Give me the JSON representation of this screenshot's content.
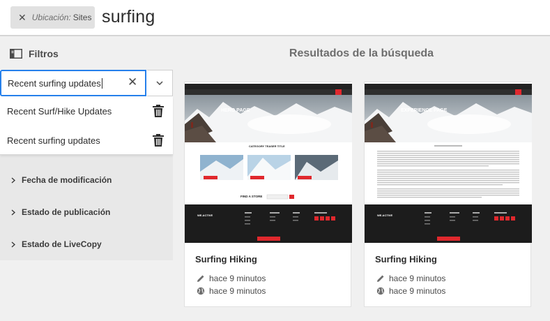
{
  "search": {
    "chip_label": "Ubicación:",
    "chip_value": "Sites",
    "query": "surfing"
  },
  "filters": {
    "title": "Filtros",
    "saved_search_value": "Recent surfing updates",
    "saved_searches": [
      {
        "label": "Recent Surf/Hike Updates"
      },
      {
        "label": "Recent surfing updates"
      }
    ],
    "sections": [
      {
        "label": "Fecha de modificación"
      },
      {
        "label": "Estado de publicación"
      },
      {
        "label": "Estado de LiveCopy"
      }
    ]
  },
  "results": {
    "title": "Resultados de la búsqueda",
    "cards": [
      {
        "title": "Surfing Hiking",
        "modified": "hace 9 minutos",
        "published": "hace 9 minutos",
        "thumb_heading": "HERO PAGE",
        "thumb_subheading": "CATEGORY TEASER TITLE",
        "thumb_find": "FIND A STORE",
        "thumb_brand": "WE.ACTIVE"
      },
      {
        "title": "Surfing Hiking",
        "modified": "hace 9 minutos",
        "published": "hace 9 minutos",
        "thumb_heading": "EXPERIENCE PAGE",
        "thumb_brand": "WE.ACTIVE"
      }
    ]
  },
  "colors": {
    "accent": "#2680eb",
    "brand_red": "#e0282d",
    "footer_dark": "#1c1c1c"
  },
  "icons": [
    "close-icon",
    "filter-panel-icon",
    "chevron-down-icon",
    "trash-icon",
    "chevron-right-icon",
    "pencil-icon",
    "globe-icon"
  ]
}
